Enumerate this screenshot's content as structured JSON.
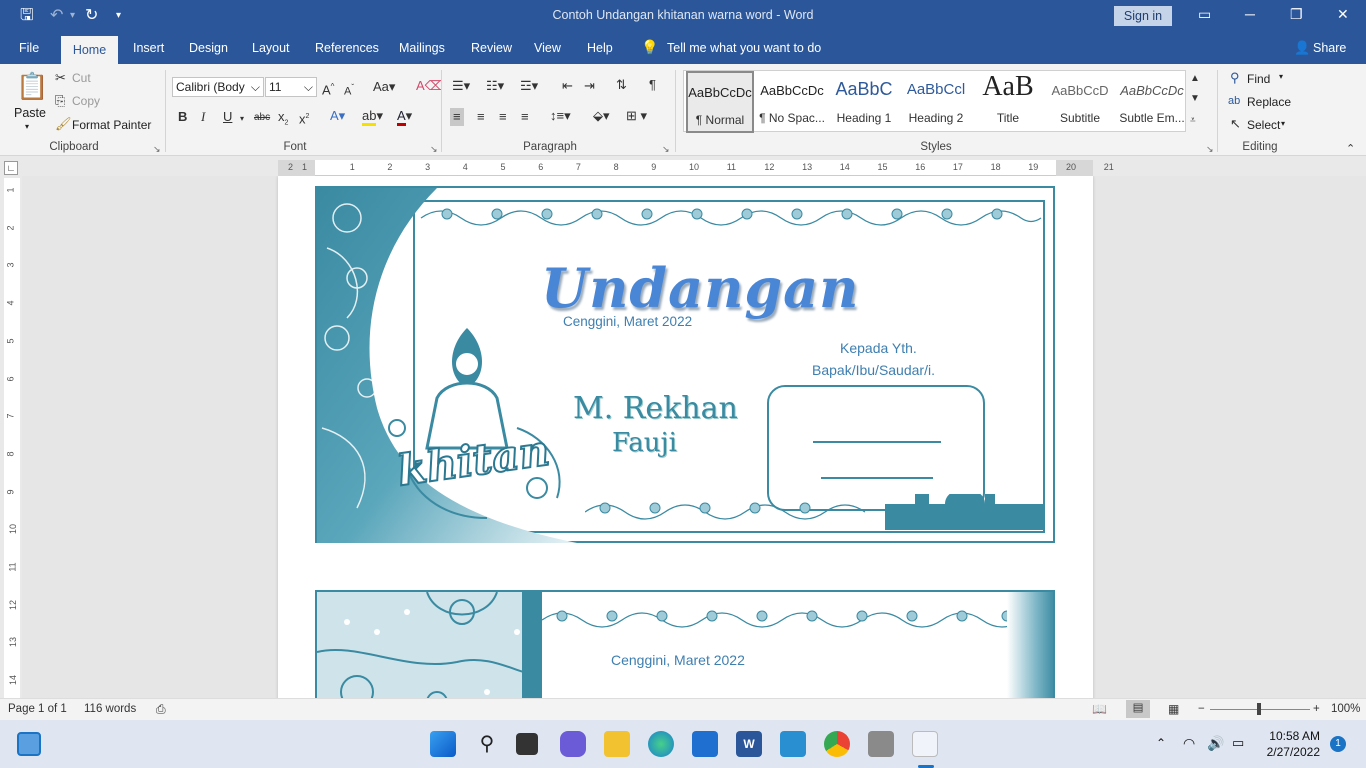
{
  "app": {
    "title": "Contoh Undangan khitanan warna word - Word",
    "sign_in": "Sign in"
  },
  "tabs": [
    "File",
    "Home",
    "Insert",
    "Design",
    "Layout",
    "References",
    "Mailings",
    "Review",
    "View",
    "Help"
  ],
  "tell_me": "Tell me what you want to do",
  "share": "Share",
  "ribbon": {
    "clipboard": {
      "label": "Clipboard",
      "paste": "Paste",
      "cut": "Cut",
      "copy": "Copy",
      "format_painter": "Format Painter"
    },
    "font": {
      "label": "Font",
      "family": "Calibri (Body",
      "size": "11"
    },
    "paragraph": {
      "label": "Paragraph"
    },
    "styles": {
      "label": "Styles",
      "items": [
        {
          "preview": "AaBbCcDc",
          "name": "¶ Normal"
        },
        {
          "preview": "AaBbCcDc",
          "name": "¶ No Spac..."
        },
        {
          "preview": "AaBbC",
          "name": "Heading 1"
        },
        {
          "preview": "AaBbCcl",
          "name": "Heading 2"
        },
        {
          "preview": "AaB",
          "name": "Title"
        },
        {
          "preview": "AaBbCcD",
          "name": "Subtitle"
        },
        {
          "preview": "AaBbCcDc",
          "name": "Subtle Em..."
        }
      ]
    },
    "editing": {
      "label": "Editing",
      "find": "Find",
      "replace": "Replace",
      "select": "Select"
    }
  },
  "ruler": [
    "1",
    "2",
    "1",
    "2",
    "3",
    "4",
    "5",
    "6",
    "7",
    "8",
    "9",
    "10",
    "11",
    "12",
    "13",
    "14",
    "15",
    "16",
    "17",
    "18",
    "19",
    "20",
    "21"
  ],
  "vruler": [
    "1",
    "2",
    "3",
    "4",
    "5",
    "6",
    "7",
    "8",
    "9",
    "10",
    "11",
    "12",
    "13",
    "14"
  ],
  "document": {
    "card1": {
      "heading": "Undangan",
      "date": "Cenggini, Maret 2022",
      "to_line1": "Kepada Yth.",
      "to_line2": "Bapak/Ibu/Saudar/i.",
      "name_line1": "M. Rekhan",
      "name_line2": "Fauji",
      "art_text": "khitan"
    },
    "card2": {
      "date": "Cenggini, Maret 2022"
    }
  },
  "status": {
    "page": "Page 1 of 1",
    "words": "116 words",
    "zoom": "100%"
  },
  "taskbar": {
    "time": "10:58 AM",
    "date": "2/27/2022",
    "notifications": "1"
  },
  "colors": {
    "word_blue": "#2b579a",
    "accent_teal": "#3a8aa2",
    "text_blue": "#3e7fb0"
  }
}
